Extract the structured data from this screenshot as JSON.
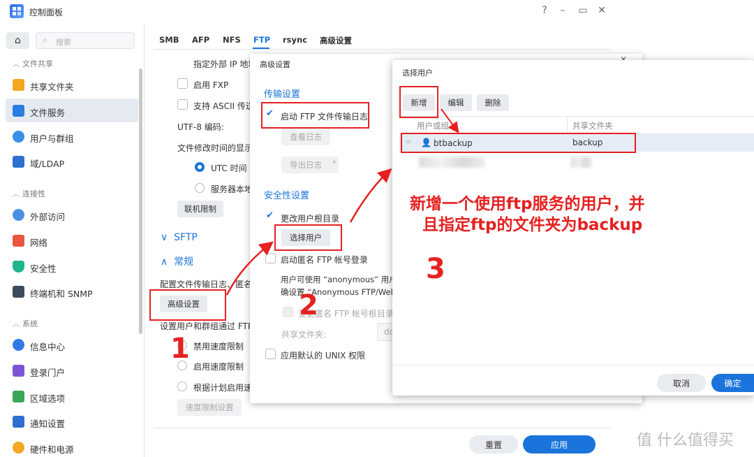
{
  "window": {
    "title": "控制面板",
    "controls": [
      "?",
      "–",
      "▭",
      "✕"
    ]
  },
  "sidebar": {
    "search_placeholder": "搜索",
    "sections": [
      {
        "label": "文件共享",
        "items": [
          {
            "label": "共享文件夹",
            "icon": "folder-icon",
            "color": "#f5a623"
          },
          {
            "label": "文件服务",
            "icon": "file-services-icon",
            "color": "#2a7de1",
            "active": true
          },
          {
            "label": "用户与群组",
            "icon": "users-icon",
            "color": "#3b8ee8"
          },
          {
            "label": "域/LDAP",
            "icon": "domain-icon",
            "color": "#2f6fcf"
          }
        ]
      },
      {
        "label": "连接性",
        "items": [
          {
            "label": "外部访问",
            "icon": "external-access-icon",
            "color": "#4a90e2"
          },
          {
            "label": "网络",
            "icon": "network-icon",
            "color": "#e8563f"
          },
          {
            "label": "安全性",
            "icon": "shield-icon",
            "color": "#1fb58f"
          },
          {
            "label": "终端机和 SNMP",
            "icon": "terminal-icon",
            "color": "#3d4b5c"
          }
        ]
      },
      {
        "label": "系统",
        "items": [
          {
            "label": "信息中心",
            "icon": "info-icon",
            "color": "#2f7ae5"
          },
          {
            "label": "登录门户",
            "icon": "login-portal-icon",
            "color": "#7a56d6"
          },
          {
            "label": "区域选项",
            "icon": "region-icon",
            "color": "#3aa65a"
          },
          {
            "label": "通知设置",
            "icon": "notification-icon",
            "color": "#2f6fcf"
          },
          {
            "label": "硬件和电源",
            "icon": "bulb-icon",
            "color": "#f5a623"
          }
        ]
      }
    ]
  },
  "main": {
    "tabs": [
      "SMB",
      "AFP",
      "NFS",
      "FTP",
      "rsync",
      "高级设置"
    ],
    "active_tab": "FTP",
    "ext_ip_label": "指定外部 IP 地址",
    "fxp_label": "启用 FXP",
    "ascii_label": "支持 ASCII 传送",
    "utf8_label": "UTF-8 编码:",
    "mtime_label": "文件修改时间的显示设",
    "utc_label": "UTC 时间",
    "server_local_label": "服务器本地",
    "conn_limit_button": "联机限制",
    "sftp_label": "SFTP",
    "general_label": "常规",
    "general_desc": "配置文件传输日志、匿名",
    "adv_button": "高级设置",
    "user_group_desc": "设置用户和群组通过 FTP",
    "speed_disable": "禁用速度限制",
    "speed_enable": "启用速度限制",
    "speed_schedule": "根据计划启用速",
    "speed_settings_button": "速度限制设置",
    "reset_button": "重置",
    "apply_button": "应用"
  },
  "adv_dialog": {
    "title": "高级设置",
    "transfer_head": "传输设置",
    "enable_log": "启动 FTP 文件传输日志",
    "view_log": "查看日志",
    "export_log": "导出日志",
    "security_head": "安全性设置",
    "change_root": "更改用户根目录",
    "select_user_button": "选择用户",
    "anon_login": "启动匿名 FTP 帐号登录",
    "anon_desc_1": "用户可使用 “anonymous” 用户",
    "anon_desc_2": "确设置 “Anonymous FTP/Web",
    "anon_root": "变更匿名 FTP 帐号根目录",
    "shared_folder_label": "共享文件夹:",
    "shared_folder_value": "do",
    "unix_perm": "应用默认的 UNIX 权限"
  },
  "select_user_dialog": {
    "title": "选择用户",
    "add_button": "新增",
    "edit_button": "编辑",
    "delete_button": "删除",
    "columns": [
      "用户或组",
      "共享文件夹"
    ],
    "rows": [
      {
        "user": "btbackup",
        "folder": "backup"
      }
    ],
    "cancel_button": "取消",
    "ok_button": "确定"
  },
  "annotations": {
    "num1": "1",
    "num2": "2",
    "num3": "3",
    "note_line1": "新增一个使用ftp服务的用户，并",
    "note_line2": "且指定ftp的文件夹为backup"
  },
  "watermark": "值 什么值得买"
}
